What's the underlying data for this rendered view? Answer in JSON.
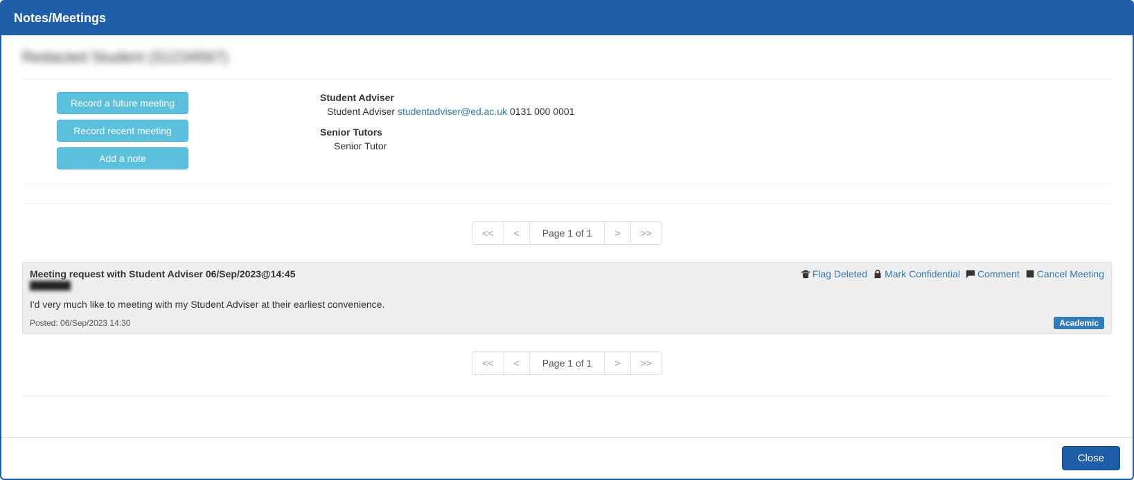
{
  "modal": {
    "title": "Notes/Meetings",
    "close_label": "Close"
  },
  "student": {
    "display_name": "Redacted Student (S1234567)"
  },
  "actions": {
    "future_meeting": "Record a future meeting",
    "recent_meeting": "Record recent meeting",
    "add_note": "Add a note"
  },
  "contacts": {
    "adviser_heading": "Student Adviser",
    "adviser_role": "Student Adviser",
    "adviser_email": "studentadviser@ed.ac.uk",
    "adviser_phone": "0131 000 0001",
    "tutors_heading": "Senior Tutors",
    "tutor_role": "Senior Tutor"
  },
  "pagination": {
    "first": "<<",
    "prev": "<",
    "label": "Page 1 of 1",
    "next": ">",
    "last": ">>"
  },
  "note": {
    "title": "Meeting request with Student Adviser 06/Sep/2023@14:45",
    "author": "Redacted",
    "body": "I'd very much like to meeting with my Student Adviser at their earliest convenience.",
    "posted": "Posted: 06/Sep/2023 14:30",
    "badge": "Academic",
    "action_flag": "Flag Deleted",
    "action_confidential": "Mark Confidential",
    "action_comment": "Comment",
    "action_cancel": "Cancel Meeting"
  }
}
